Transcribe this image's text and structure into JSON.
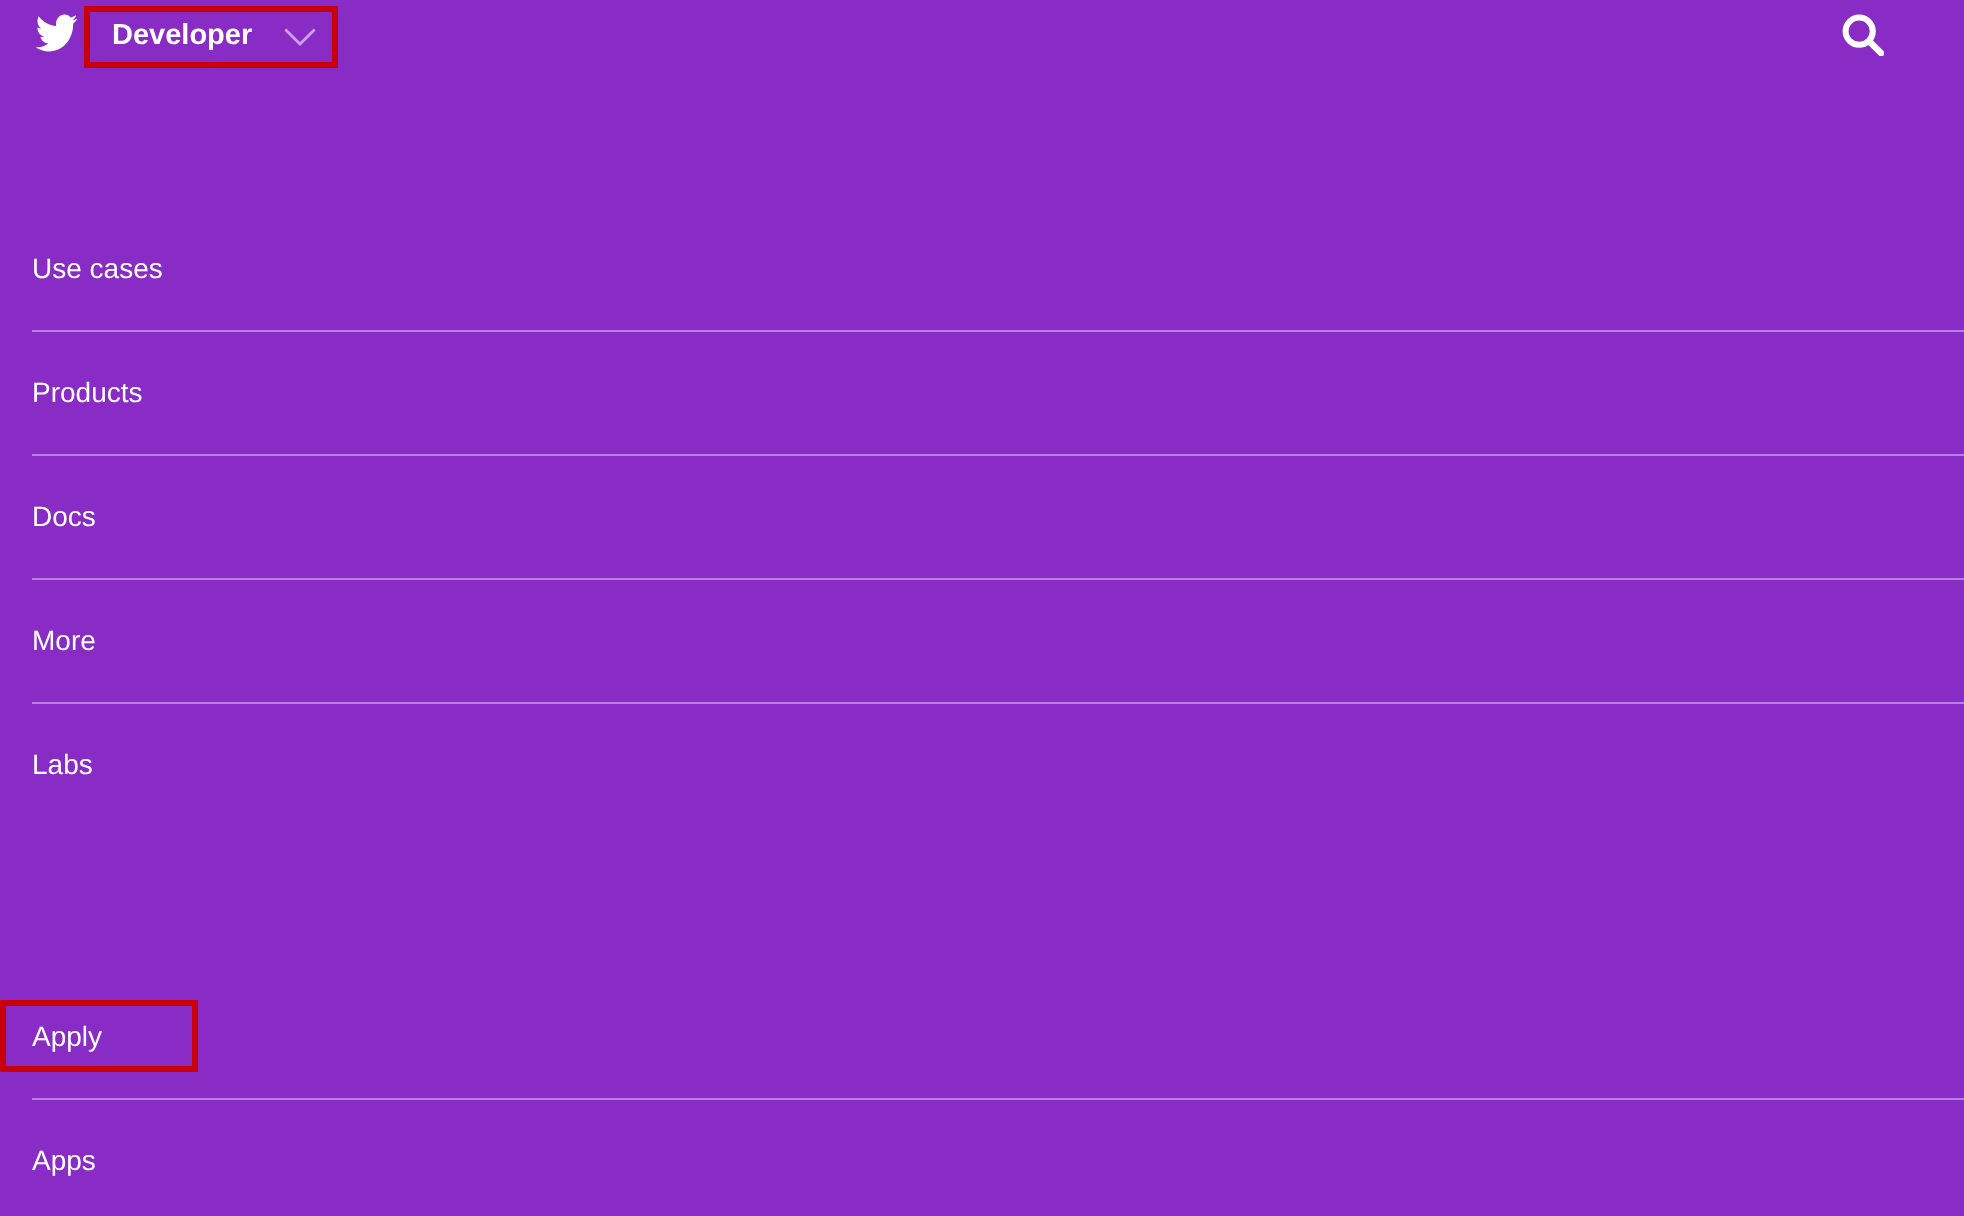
{
  "header": {
    "brand": {
      "label": "Developer",
      "highlighted": true
    }
  },
  "menu_sections": [
    {
      "items": [
        {
          "label": "Use cases",
          "highlighted": false
        },
        {
          "label": "Products",
          "highlighted": false
        },
        {
          "label": "Docs",
          "highlighted": false
        },
        {
          "label": "More",
          "highlighted": false
        },
        {
          "label": "Labs",
          "highlighted": false
        }
      ]
    },
    {
      "items": [
        {
          "label": "Apply",
          "highlighted": true
        },
        {
          "label": "Apps",
          "highlighted": false
        }
      ]
    }
  ]
}
